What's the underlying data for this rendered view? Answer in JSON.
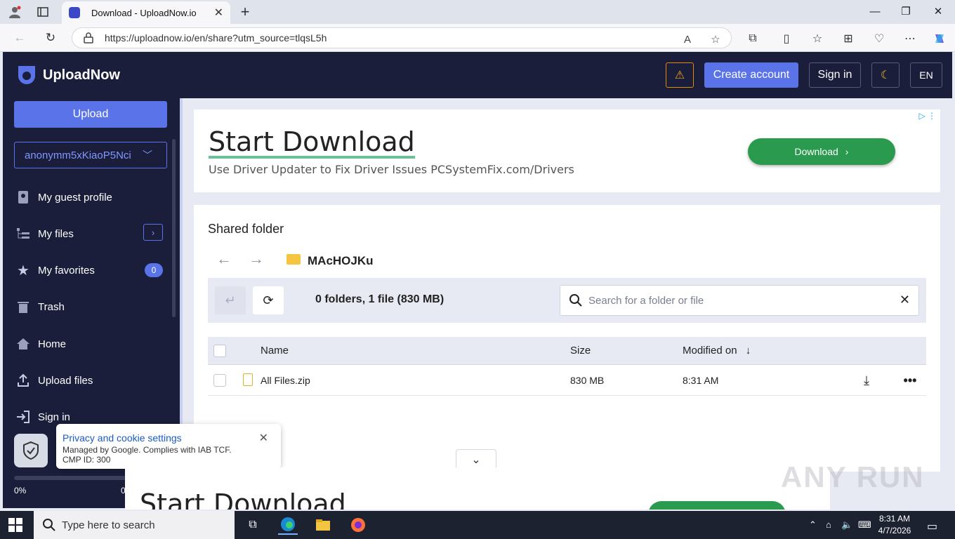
{
  "browser": {
    "tab_title": "Download - UploadNow.io",
    "url": "https://uploadnow.io/en/share?utm_source=tlqsL5h"
  },
  "header": {
    "brand": "UploadNow",
    "create_account": "Create account",
    "sign_in": "Sign in",
    "language": "EN"
  },
  "sidebar": {
    "upload": "Upload",
    "account": "anonymm5xKiaoP5Nci",
    "items": [
      {
        "label": "My guest profile"
      },
      {
        "label": "My files"
      },
      {
        "label": "My favorites",
        "badge": "0"
      },
      {
        "label": "Trash"
      },
      {
        "label": "Home"
      },
      {
        "label": "Upload files"
      },
      {
        "label": "Sign in"
      }
    ],
    "storage_percent_left": "0%",
    "storage_percent_right": "0"
  },
  "ad": {
    "headline": "Start Download",
    "subtext": "Use Driver Updater to Fix Driver Issues PCSystemFix.com/Drivers",
    "button": "Download"
  },
  "panel": {
    "title": "Shared folder",
    "folder_name": "MAcHOJKu",
    "summary": "0 folders, 1 file (830 MB)",
    "search_placeholder": "Search for a folder or file",
    "columns": {
      "name": "Name",
      "size": "Size",
      "modified": "Modified on"
    },
    "files": [
      {
        "name": "All Files.zip",
        "size": "830 MB",
        "modified": "8:31 AM"
      }
    ]
  },
  "cookie": {
    "title": "Privacy and cookie settings",
    "line1": "Managed by Google. Complies with IAB TCF.",
    "line2": "CMP ID: 300"
  },
  "ad2": {
    "headline": "Start Download"
  },
  "watermark": "ANY RUN",
  "taskbar": {
    "search_placeholder": "Type here to search",
    "time": "8:31 AM",
    "date": "4/7/2026"
  }
}
